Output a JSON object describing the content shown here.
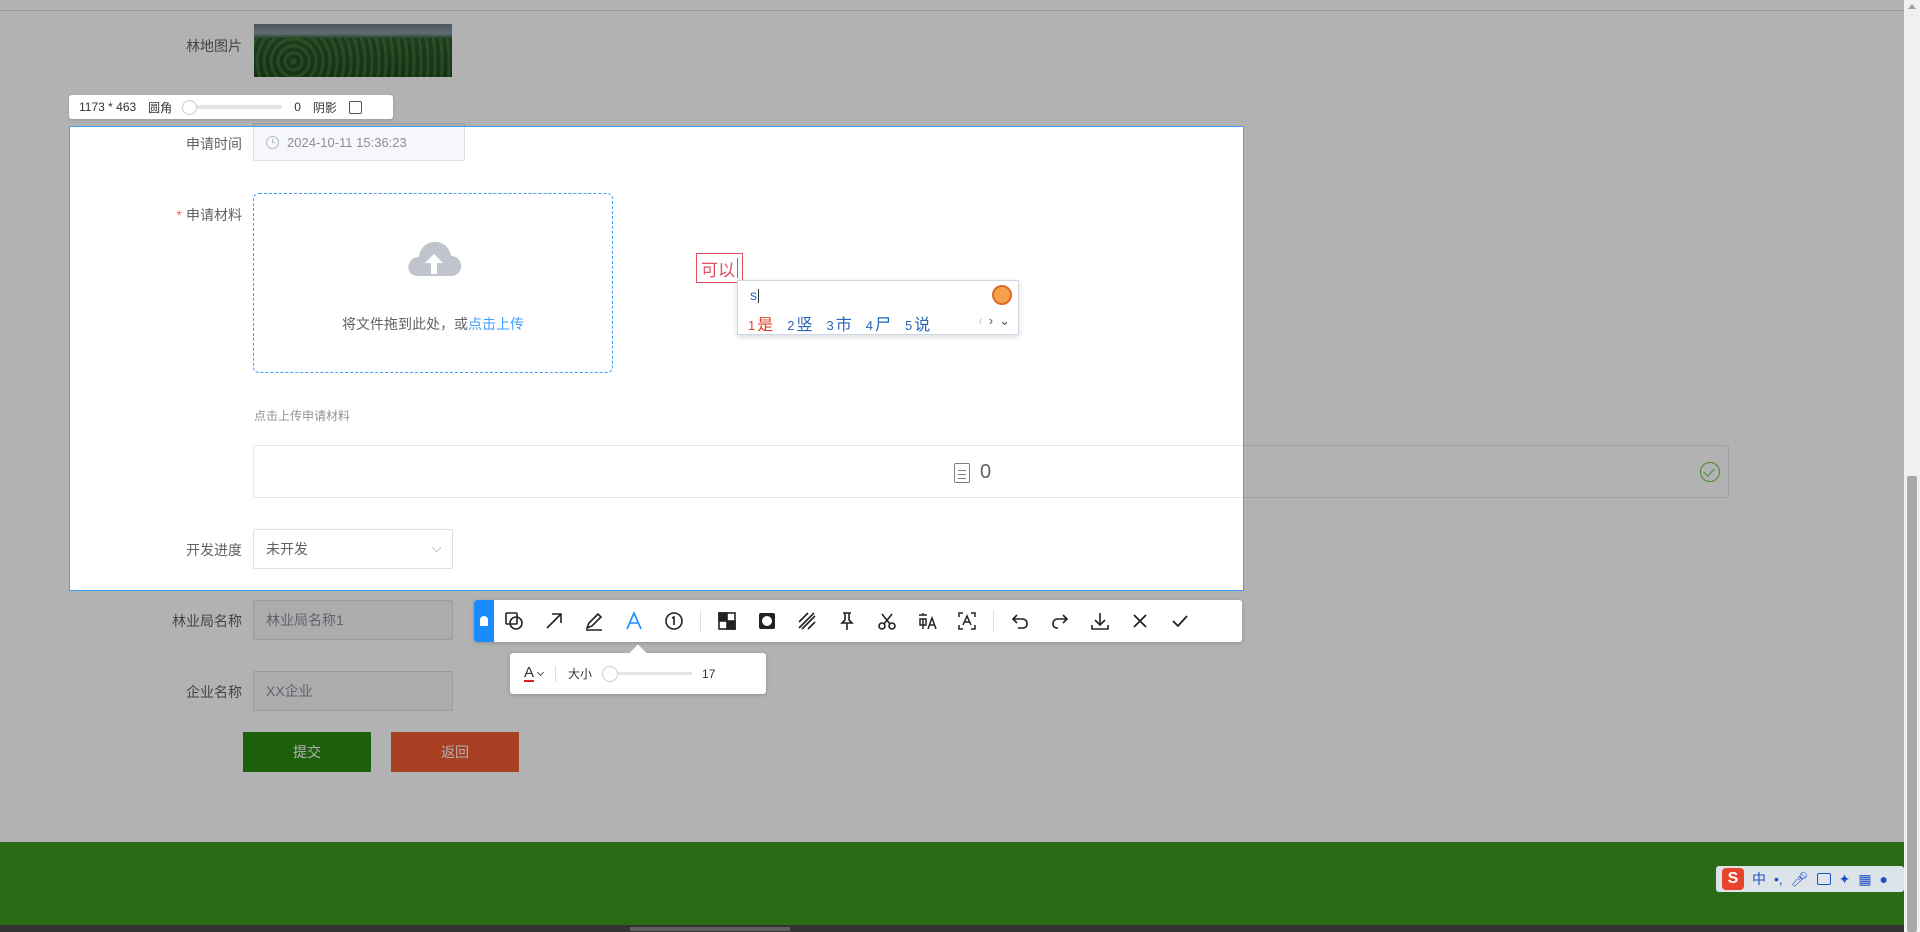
{
  "form": {
    "labels": {
      "forest_image": "林地图片",
      "apply_time": "申请时间",
      "apply_material": "申请材料",
      "dev_progress": "开发进度",
      "bureau_name": "林业局名称",
      "company_name": "企业名称"
    },
    "required_mark": "*",
    "apply_time_value": "2024-10-11 15:36:23",
    "upload": {
      "text": "将文件拖到此处，或",
      "link": "点击上传"
    },
    "upload_hint": "点击上传申请材料",
    "file_count": "0",
    "dev_progress_value": "未开发",
    "bureau_name_value": "林业局名称1",
    "company_name_value": "XX企业",
    "submit_label": "提交",
    "back_label": "返回"
  },
  "capture": {
    "size_text": "1173 * 463",
    "radius_label": "圆角",
    "radius_value": "0",
    "shadow_label": "阴影",
    "annotation_text": "可以",
    "text_size_label": "大小",
    "text_size_value": "17",
    "text_color": "#e02020",
    "tools": [
      "pin-icon",
      "shape-icon",
      "arrow-icon",
      "pen-icon",
      "text-icon",
      "number-icon",
      "mosaic-icon",
      "blur-icon",
      "hatch-icon",
      "pin-top-icon",
      "scissors-icon",
      "translate-icon",
      "ocr-icon",
      "undo-icon",
      "redo-icon",
      "download-icon",
      "close-icon",
      "confirm-icon"
    ]
  },
  "ime": {
    "input": "s",
    "candidates": [
      {
        "num": "1",
        "text": "是"
      },
      {
        "num": "2",
        "text": "竖"
      },
      {
        "num": "3",
        "text": "市"
      },
      {
        "num": "4",
        "text": "尸"
      },
      {
        "num": "5",
        "text": "说"
      }
    ],
    "status_mode": "中",
    "status_punct": "•,"
  },
  "colors": {
    "accent": "#409eff",
    "submit": "#2a8a12",
    "back": "#f15a32",
    "footer": "#3d9a1f",
    "annotation": "#e05060"
  }
}
